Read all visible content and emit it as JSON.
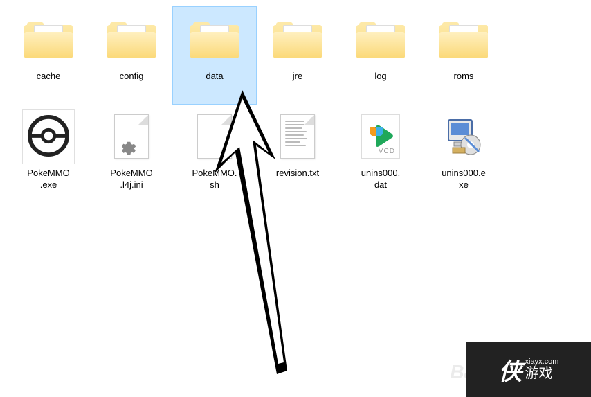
{
  "files": [
    {
      "name": "cache",
      "type": "folder",
      "selected": false
    },
    {
      "name": "config",
      "type": "folder",
      "selected": false
    },
    {
      "name": "data",
      "type": "folder",
      "selected": true
    },
    {
      "name": "jre",
      "type": "folder",
      "selected": false
    },
    {
      "name": "log",
      "type": "folder",
      "selected": false
    },
    {
      "name": "roms",
      "type": "folder",
      "selected": false
    },
    {
      "name": "PokeMMO\n.exe",
      "type": "pokemmo-exe",
      "selected": false
    },
    {
      "name": "PokeMMO\n.l4j.ini",
      "type": "ini",
      "selected": false
    },
    {
      "name": "PokeMMO.\nsh",
      "type": "blank",
      "selected": false
    },
    {
      "name": "revision.txt",
      "type": "text",
      "selected": false
    },
    {
      "name": "unins000.\ndat",
      "type": "vcd",
      "selected": false
    },
    {
      "name": "unins000.e\nxe",
      "type": "installer",
      "selected": false
    }
  ],
  "watermark": {
    "brand": "侠",
    "site": "xiayx.com",
    "gametext": "游戏"
  },
  "baidu_watermark": "Bai"
}
